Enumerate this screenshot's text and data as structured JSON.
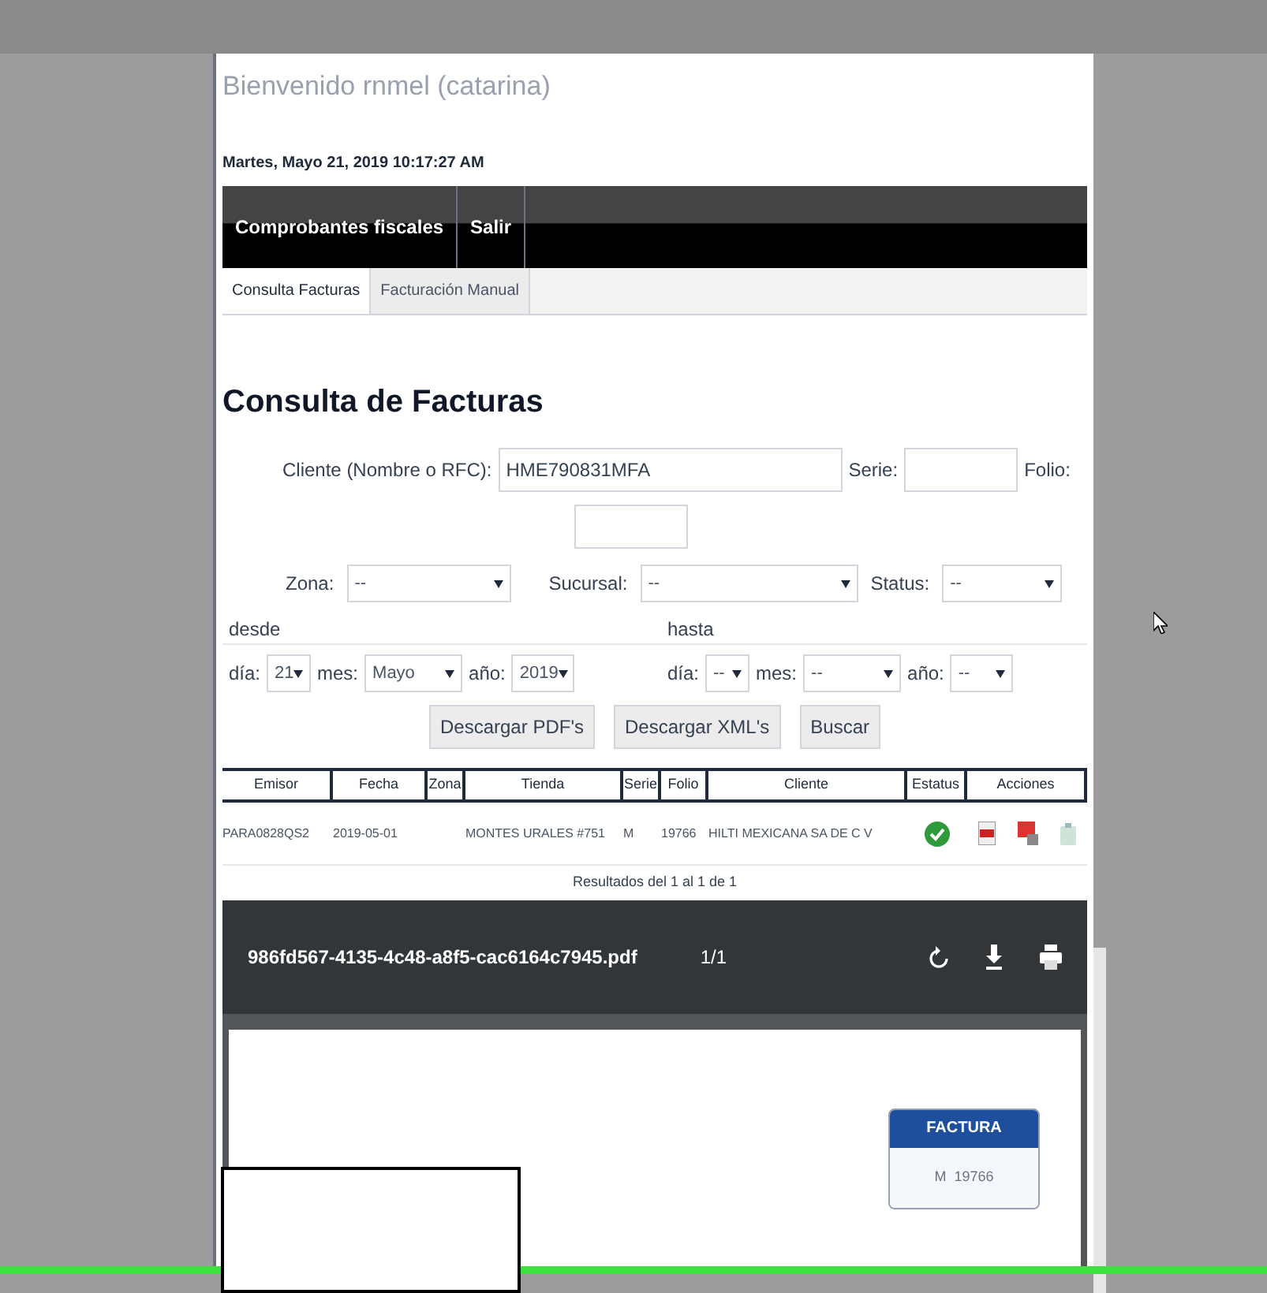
{
  "welcome": "Bienvenido rnmel  (catarina)",
  "date": "Martes, Mayo 21, 2019 10:17:27 AM",
  "nav": [
    {
      "label": "Comprobantes fiscales"
    },
    {
      "label": "Salir"
    }
  ],
  "subtabs": [
    {
      "label": "Consulta Facturas",
      "selected": true
    },
    {
      "label": "Facturación Manual",
      "selected": false
    }
  ],
  "heading": "Consulta de Facturas",
  "filters": {
    "cliente_label": "Cliente (Nombre o RFC):",
    "cliente_value": "HME790831MFA",
    "serie_label": "Serie:",
    "folio_label": "Folio:",
    "zona_label": "Zona:",
    "zona_value": "--",
    "sucursal_label": "Sucursal:",
    "sucursal_value": "--",
    "status_label": "Status:",
    "status_value": "--",
    "desde": "desde",
    "hasta": "hasta",
    "from": [
      {
        "label": "día:",
        "value": "21"
      },
      {
        "label": "mes:",
        "value": "Mayo"
      },
      {
        "label": "año:",
        "value": "2019"
      }
    ],
    "to": [
      {
        "label": "día:",
        "value": "--"
      },
      {
        "label": "mes:",
        "value": "--"
      },
      {
        "label": "año:",
        "value": "--"
      }
    ]
  },
  "buttons": [
    "Descargar PDF's",
    "Descargar XML's",
    "Buscar"
  ],
  "table": {
    "columns": [
      "Emisor",
      "Fecha",
      "Zona",
      "Tienda",
      "Serie",
      "Folio",
      "Cliente",
      "Estatus",
      "Acciones"
    ],
    "rows": [
      {
        "cells": [
          "PARA0828QS2",
          "2019-05-01",
          "",
          "MONTES URALES #751",
          "M",
          "19766",
          "HILTI MEXICANA SA DE C V"
        ],
        "status_ok": true
      }
    ]
  },
  "results": "Resultados del 1 al 1 de 1",
  "viewer": {
    "filename": "986fd567-4135-4c48-a8f5-cac6164c7945.pdf",
    "pages": "1/1",
    "badge_title": "FACTURA",
    "badge_value": "M  19766"
  }
}
